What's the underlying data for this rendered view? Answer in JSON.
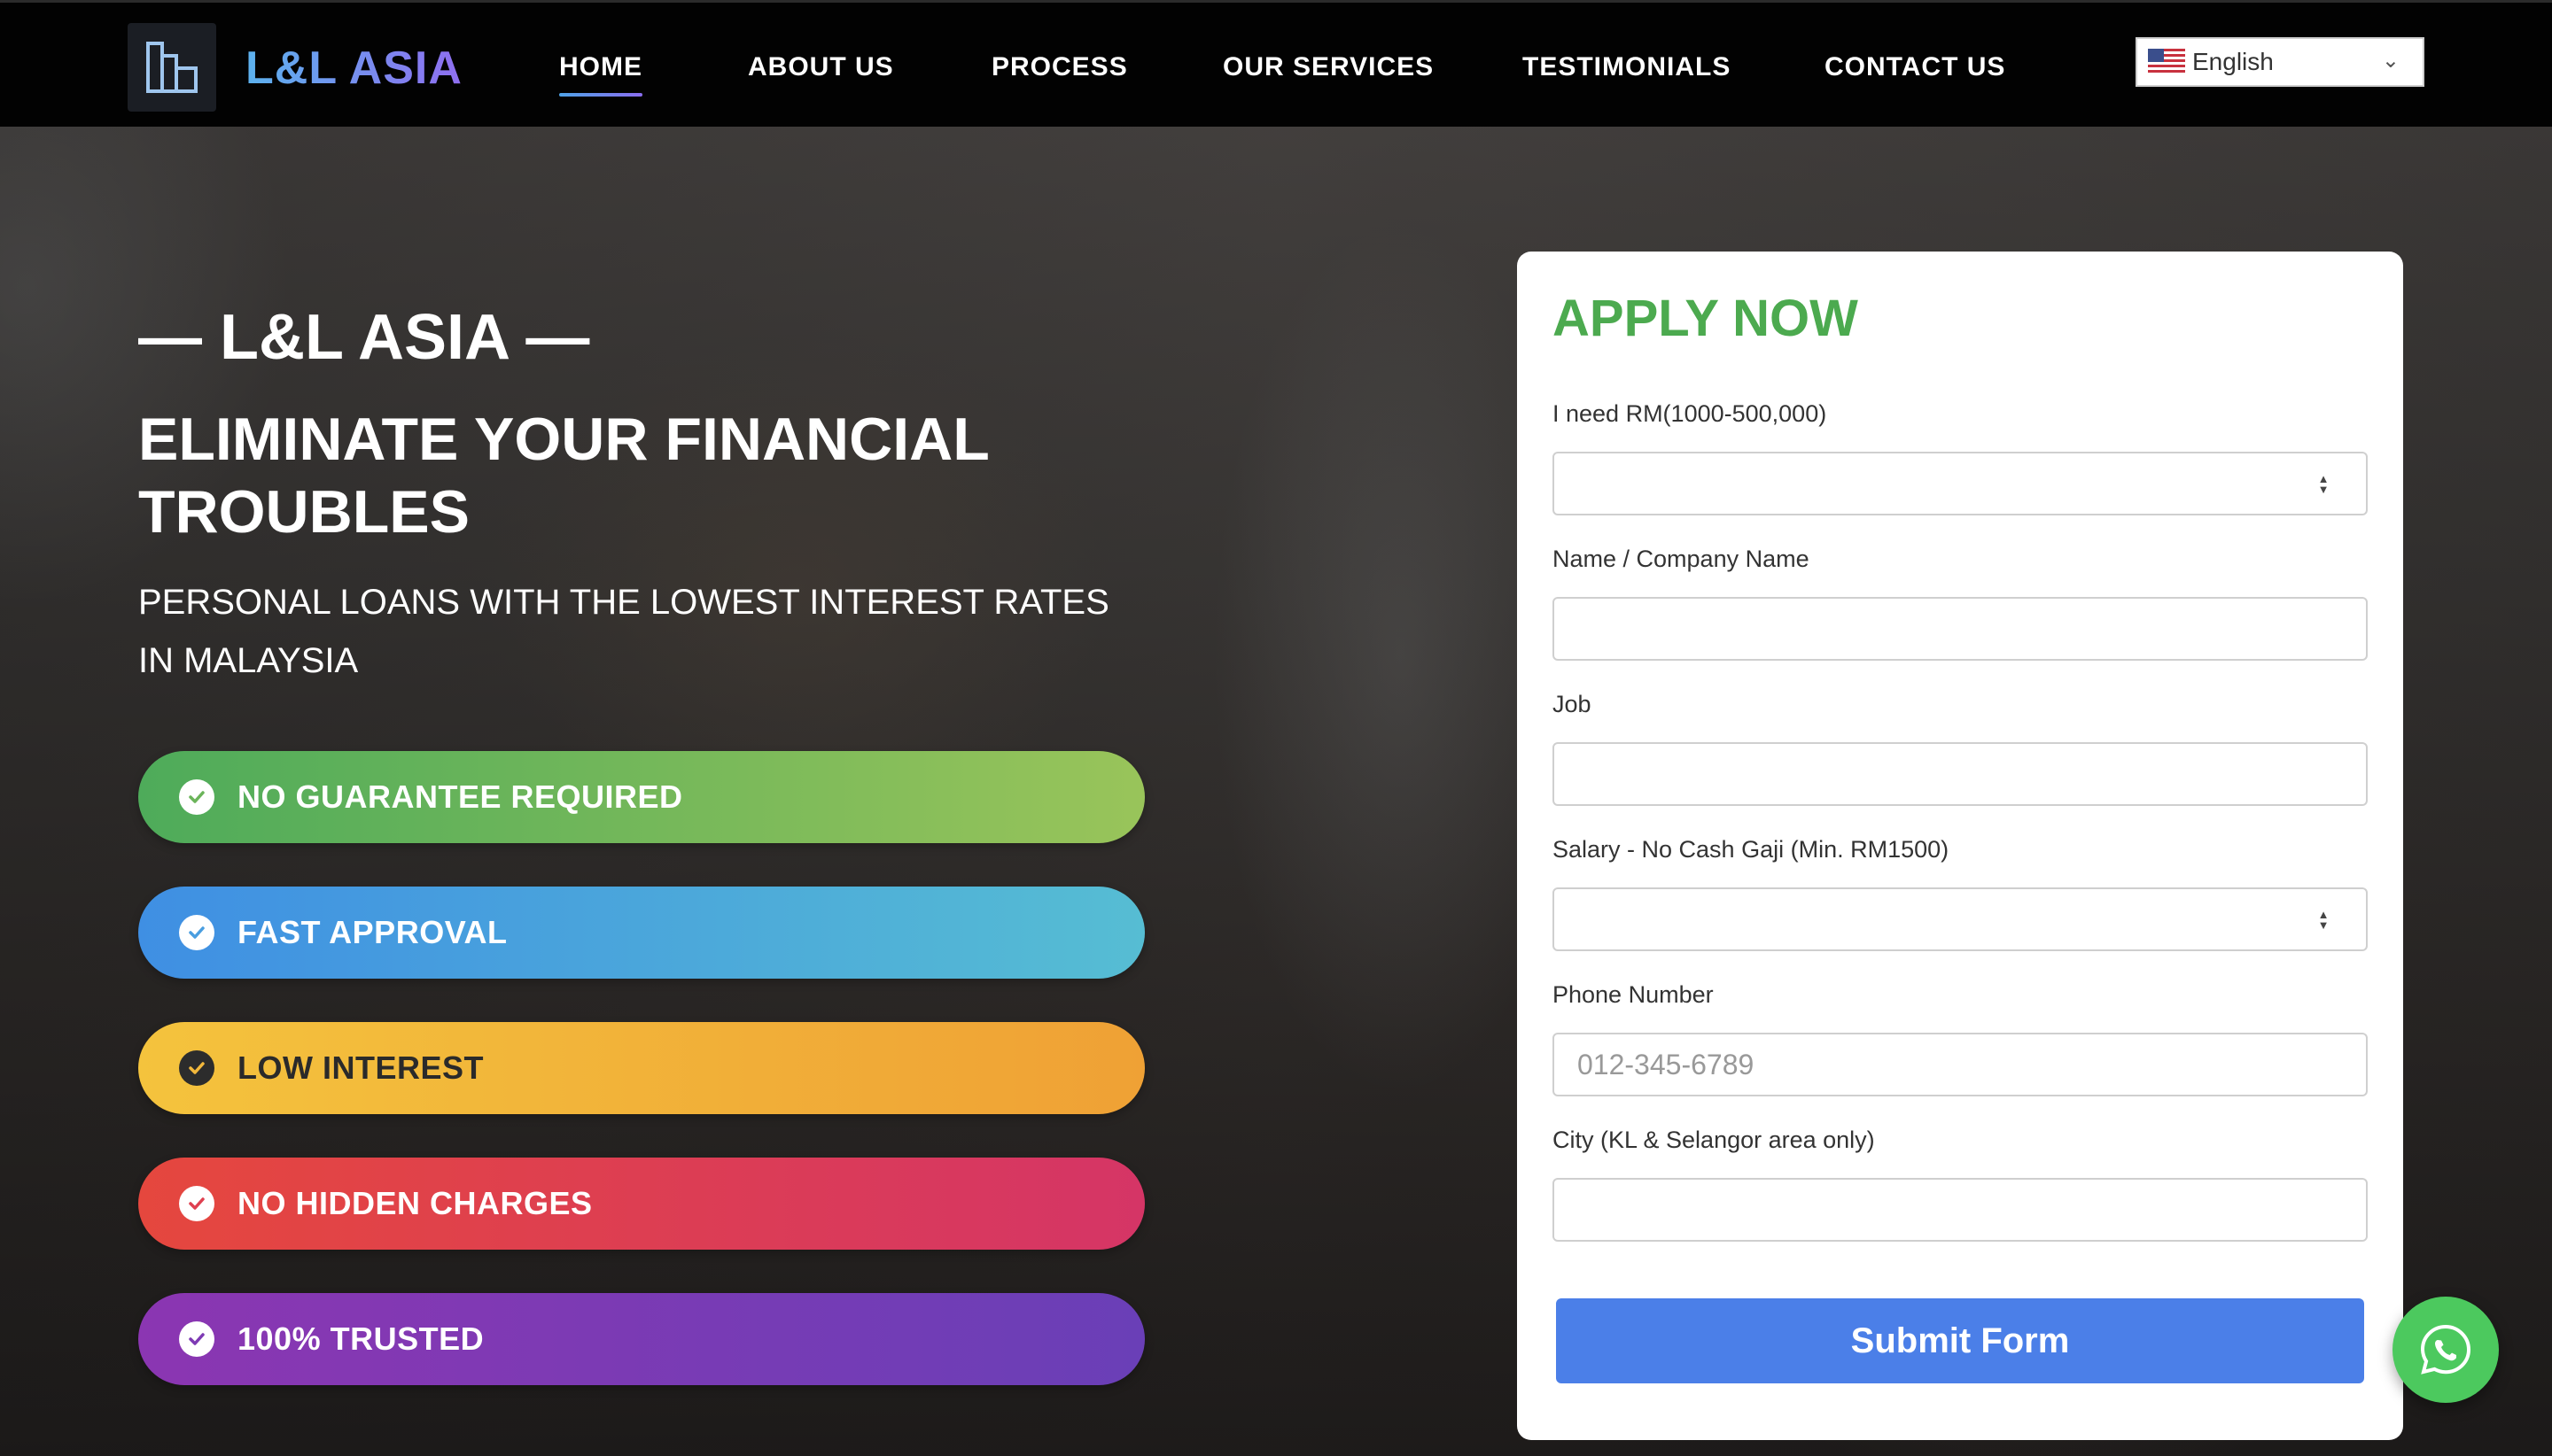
{
  "nav": {
    "logo_text": "L&L ASIA",
    "items": [
      {
        "label": "HOME",
        "active": true
      },
      {
        "label": "ABOUT US"
      },
      {
        "label": "PROCESS"
      },
      {
        "label": "OUR SERVICES"
      },
      {
        "label": "TESTIMONIALS"
      },
      {
        "label": "CONTACT US"
      }
    ],
    "language": {
      "selected": "English",
      "flag_icon": "us-flag-icon"
    }
  },
  "hero": {
    "brand_line": "— L&L ASIA —",
    "headline": "ELIMINATE YOUR FINANCIAL TROUBLES",
    "subline": "PERSONAL LOANS WITH THE LOWEST INTEREST RATES IN MALAYSIA",
    "features": [
      {
        "label": "NO GUARANTEE REQUIRED",
        "color_from": "#4eab5a",
        "color_to": "#99c45a"
      },
      {
        "label": "FAST APPROVAL",
        "color_from": "#3f8fe3",
        "color_to": "#56bdd3"
      },
      {
        "label": "LOW INTEREST",
        "color_from": "#f4c33d",
        "color_to": "#efa135"
      },
      {
        "label": "NO HIDDEN CHARGES",
        "color_from": "#e5473e",
        "color_to": "#d53566"
      },
      {
        "label": "100% TRUSTED",
        "color_from": "#8b36b2",
        "color_to": "#6a3fb7"
      }
    ]
  },
  "form": {
    "title": "APPLY NOW",
    "fields": [
      {
        "label": "I need RM(1000-500,000)",
        "placeholder": "",
        "type": "number"
      },
      {
        "label": "Name / Company Name",
        "placeholder": "",
        "type": "text"
      },
      {
        "label": "Job",
        "placeholder": "",
        "type": "text"
      },
      {
        "label": "Salary - No Cash Gaji (Min. RM1500)",
        "placeholder": "",
        "type": "number"
      },
      {
        "label": "Phone Number",
        "placeholder": "012-345-6789",
        "type": "text"
      },
      {
        "label": "City (KL & Selangor area only)",
        "placeholder": "",
        "type": "text"
      }
    ],
    "submit_label": "Submit Form"
  },
  "colors": {
    "title_green": "#4caa4f",
    "submit_blue": "#4b7fe8",
    "whatsapp_green": "#4cc95e"
  }
}
